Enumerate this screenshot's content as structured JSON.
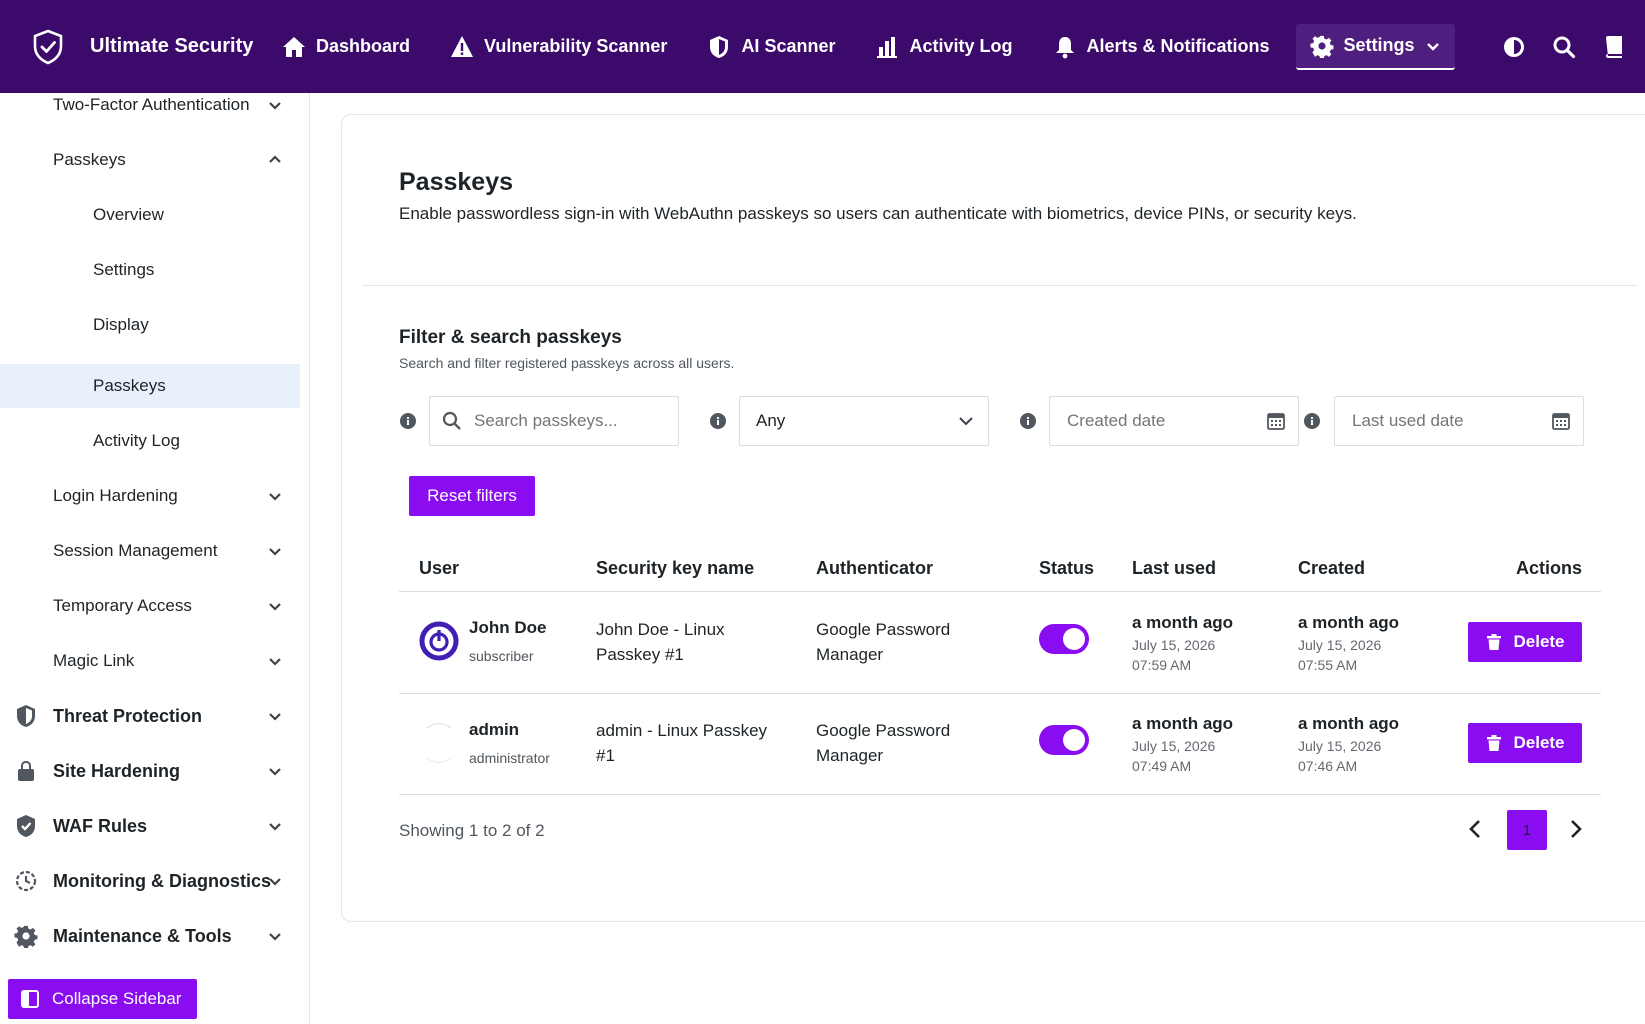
{
  "brand": {
    "name": "Ultimate Security"
  },
  "nav": {
    "items": [
      {
        "label": "Dashboard"
      },
      {
        "label": "Vulnerability Scanner"
      },
      {
        "label": "AI Scanner"
      },
      {
        "label": "Activity Log"
      },
      {
        "label": "Alerts & Notifications"
      },
      {
        "label": "Settings"
      }
    ]
  },
  "sidebar": {
    "items": [
      {
        "label": "Two-Factor Authentication"
      },
      {
        "label": "Passkeys"
      },
      {
        "label": "Overview"
      },
      {
        "label": "Settings"
      },
      {
        "label": "Display"
      },
      {
        "label": "Passkeys"
      },
      {
        "label": "Activity Log"
      },
      {
        "label": "Login Hardening"
      },
      {
        "label": "Session Management"
      },
      {
        "label": "Temporary Access"
      },
      {
        "label": "Magic Link"
      },
      {
        "label": "Threat Protection"
      },
      {
        "label": "Site Hardening"
      },
      {
        "label": "WAF Rules"
      },
      {
        "label": "Monitoring & Diagnostics"
      },
      {
        "label": "Maintenance & Tools"
      }
    ],
    "collapse_label": "Collapse Sidebar"
  },
  "page": {
    "title": "Passkeys",
    "description": "Enable passwordless sign-in with WebAuthn passkeys so users can authenticate with biometrics, device PINs, or security keys."
  },
  "filters": {
    "title": "Filter & search passkeys",
    "description": "Search and filter registered passkeys across all users.",
    "search_placeholder": "Search passkeys...",
    "select_value": "Any",
    "created_placeholder": "Created date",
    "last_used_placeholder": "Last used date",
    "reset_label": "Reset filters"
  },
  "table": {
    "headers": [
      "User",
      "Security key name",
      "Authenticator",
      "Status",
      "Last used",
      "Created",
      "Actions"
    ],
    "rows": [
      {
        "user": "John Doe",
        "role": "subscriber",
        "key_name": "John Doe - Linux Passkey #1",
        "authenticator": "Google Password Manager",
        "enabled": true,
        "last_used": "a month ago",
        "last_used_date": "July 15, 2026",
        "last_used_time": "07:59 AM",
        "created": "a month ago",
        "created_date": "July 15, 2026",
        "created_time": "07:55 AM",
        "action": "Delete"
      },
      {
        "user": "admin",
        "role": "administrator",
        "key_name": "admin - Linux Passkey #1",
        "authenticator": "Google Password Manager",
        "enabled": true,
        "last_used": "a month ago",
        "last_used_date": "July 15, 2026",
        "last_used_time": "07:49 AM",
        "created": "a month ago",
        "created_date": "July 15, 2026",
        "created_time": "07:46 AM",
        "action": "Delete"
      }
    ]
  },
  "pagination": {
    "summary": "Showing 1 to 2 of 2",
    "current": "1"
  },
  "colors": {
    "topbar": "#3c0a6b",
    "accent": "#8a0cf0",
    "selected": "#e8f0fb"
  }
}
